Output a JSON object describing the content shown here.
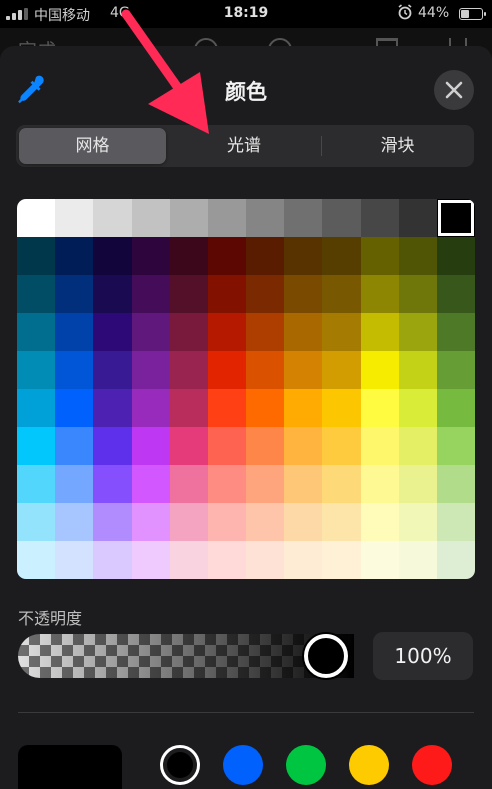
{
  "status_bar": {
    "carrier": "中国移动",
    "network": "4G",
    "time": "18:19",
    "battery_percent": "44%",
    "battery_level": 0.44,
    "alarm_icon": "alarm-clock-icon"
  },
  "background_toolbar": {
    "done_label": "完成"
  },
  "sheet": {
    "title": "颜色",
    "eyedropper_icon": "eyedropper-icon",
    "close_icon": "close-icon",
    "tabs": [
      {
        "label": "网格",
        "active": true
      },
      {
        "label": "光谱",
        "active": false
      },
      {
        "label": "滑块",
        "active": false
      }
    ],
    "grid": {
      "selected": {
        "row": 0,
        "col": 11
      },
      "rows": [
        [
          "#ffffff",
          "#ebebeb",
          "#d6d6d6",
          "#c2c2c2",
          "#adadad",
          "#999999",
          "#858585",
          "#707070",
          "#5c5c5c",
          "#474747",
          "#333333",
          "#000000"
        ],
        [
          "#00374a",
          "#011d57",
          "#11053b",
          "#2e063d",
          "#3c071b",
          "#5c0701",
          "#5a1c00",
          "#583300",
          "#563d00",
          "#666100",
          "#4f5504",
          "#263e0f"
        ],
        [
          "#004d65",
          "#012f7b",
          "#1a0a52",
          "#450d59",
          "#551029",
          "#831100",
          "#7b2900",
          "#7a4a00",
          "#785800",
          "#8d8602",
          "#6f760a",
          "#38571a"
        ],
        [
          "#016e8f",
          "#0042a9",
          "#2c0977",
          "#61187c",
          "#791a3d",
          "#b51a00",
          "#ad3e00",
          "#a96800",
          "#a67b01",
          "#c4bc00",
          "#9ba50e",
          "#4e7a27"
        ],
        [
          "#008cb4",
          "#0056d6",
          "#371a94",
          "#7a219e",
          "#99244f",
          "#e22400",
          "#da5100",
          "#d38301",
          "#d19d01",
          "#f5ec00",
          "#c3d117",
          "#669d34"
        ],
        [
          "#00a1d8",
          "#0061fd",
          "#4d22b2",
          "#982abc",
          "#b92d5d",
          "#ff4015",
          "#ff6a00",
          "#ffab01",
          "#fcc700",
          "#fefb41",
          "#d9ec37",
          "#76bb40"
        ],
        [
          "#01c7fc",
          "#3a87fd",
          "#5e30eb",
          "#be38f3",
          "#e63b7a",
          "#fe6250",
          "#fe8648",
          "#feb43f",
          "#fecb3e",
          "#fff76b",
          "#e4ef65",
          "#96d35f"
        ],
        [
          "#52d6fc",
          "#74a7ff",
          "#864ffd",
          "#d357fe",
          "#ee719e",
          "#ff8c82",
          "#fea57d",
          "#fec777",
          "#fed977",
          "#fff994",
          "#eaf28f",
          "#b1dd8b"
        ],
        [
          "#93e3fc",
          "#a7c6ff",
          "#b18cfe",
          "#e292fe",
          "#f4a4c0",
          "#ffb5af",
          "#ffc5ab",
          "#fed9a8",
          "#fde4a8",
          "#fffbb9",
          "#f1f7b7",
          "#cde8b5"
        ],
        [
          "#cbf0ff",
          "#d3e2ff",
          "#d9c9fe",
          "#efcaff",
          "#f9d3e0",
          "#ffdad8",
          "#ffe2d6",
          "#feecd4",
          "#fef1d5",
          "#fdfbdd",
          "#f6fadb",
          "#deeed4"
        ]
      ]
    },
    "opacity": {
      "label": "不透明度",
      "value_text": "100%",
      "value": 1.0
    },
    "current_color": "#000000",
    "swatches": [
      {
        "color": "#000000",
        "selected": true
      },
      {
        "color": "#0061fd",
        "selected": false
      },
      {
        "color": "#00c541",
        "selected": false
      },
      {
        "color": "#fecb00",
        "selected": false
      },
      {
        "color": "#ff1a1a",
        "selected": false
      }
    ]
  },
  "colors": {
    "sheet_background": "#1c1c1e",
    "annotation_arrow": "#ff2a55"
  }
}
